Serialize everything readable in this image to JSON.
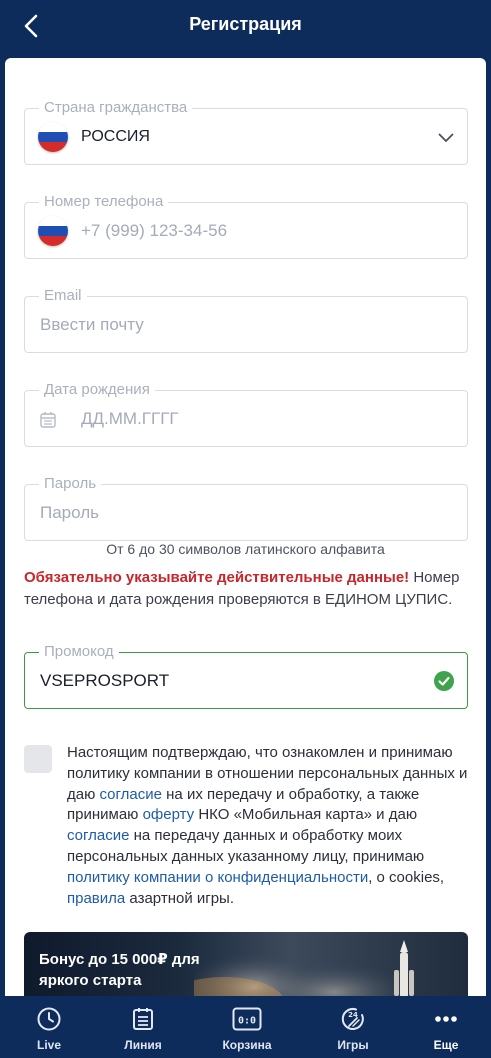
{
  "header": {
    "title": "Регистрация"
  },
  "form": {
    "country": {
      "label": "Страна гражданства",
      "value": "РОССИЯ"
    },
    "phone": {
      "label": "Номер телефона",
      "placeholder": "+7 (999) 123-34-56"
    },
    "email": {
      "label": "Email",
      "placeholder": "Ввести почту"
    },
    "birthdate": {
      "label": "Дата рождения",
      "placeholder": "ДД.ММ.ГГГГ"
    },
    "password": {
      "label": "Пароль",
      "placeholder": "Пароль",
      "hint": "От 6 до 30 символов латинского алфавита"
    },
    "warning": {
      "bold": "Обязательно указывайте действительные данные!",
      "rest": " Номер телефона и дата рождения проверяются в ЕДИНОМ ЦУПИС."
    },
    "promo": {
      "label": "Промокод",
      "value": "VSEPROSPORT"
    }
  },
  "consent": {
    "t1": "Настоящим подтверждаю, что ознакомлен и принимаю политику компании в отношении персональных данных и даю ",
    "l1": "согласие",
    "t2": " на их передачу и обработку, а также принимаю ",
    "l2": "оферту",
    "t3": " НКО «Мобильная карта» и даю ",
    "l3": "согласие",
    "t4": " на передачу данных и обработку моих персональных данных указанному лицу, принимаю ",
    "l4": "политику компании о конфиденциальности",
    "t5": ", о cookies, ",
    "l5": "правила",
    "t6": " азартной игры."
  },
  "banner": {
    "title": "Бонус до 15 000₽ для яркого старта"
  },
  "nav": {
    "items": [
      {
        "label": "Live"
      },
      {
        "label": "Линия"
      },
      {
        "label": "Корзина"
      },
      {
        "label": "Игры"
      },
      {
        "label": "Еще"
      }
    ]
  },
  "colors": {
    "brand": "#0d2c5b",
    "accent_link": "#1f5ca8",
    "warning": "#c8262b",
    "success": "#3fa34d"
  }
}
